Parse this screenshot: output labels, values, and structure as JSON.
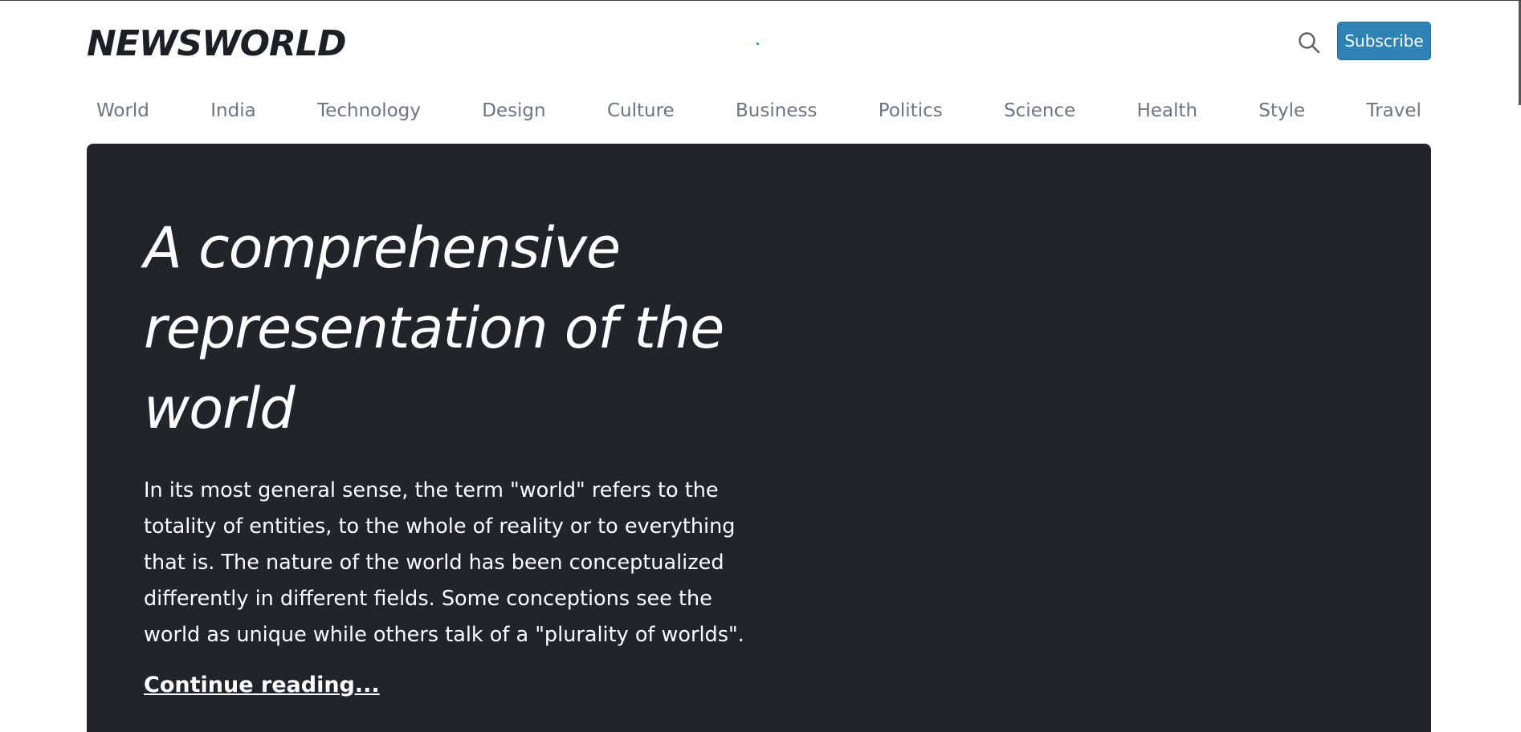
{
  "header": {
    "logo_text": "NEWSWORLD",
    "search_icon": "search-icon",
    "subscribe_label": "Subscribe",
    "accent_color": "#2e83b4"
  },
  "nav": {
    "items": [
      {
        "label": "World"
      },
      {
        "label": "India"
      },
      {
        "label": "Technology"
      },
      {
        "label": "Design"
      },
      {
        "label": "Culture"
      },
      {
        "label": "Business"
      },
      {
        "label": "Politics"
      },
      {
        "label": "Science"
      },
      {
        "label": "Health"
      },
      {
        "label": "Style"
      },
      {
        "label": "Travel"
      }
    ]
  },
  "hero": {
    "title": "A comprehensive representation of the world",
    "lead": "In its most general sense, the term \"world\" refers to the totality of entities, to the whole of reality or to everything that is. The nature of the world has been conceptualized differently in different fields. Some conceptions see the world as unique while others talk of a \"plurality of worlds\".",
    "link_label": "Continue reading...",
    "background_color": "#212529"
  }
}
